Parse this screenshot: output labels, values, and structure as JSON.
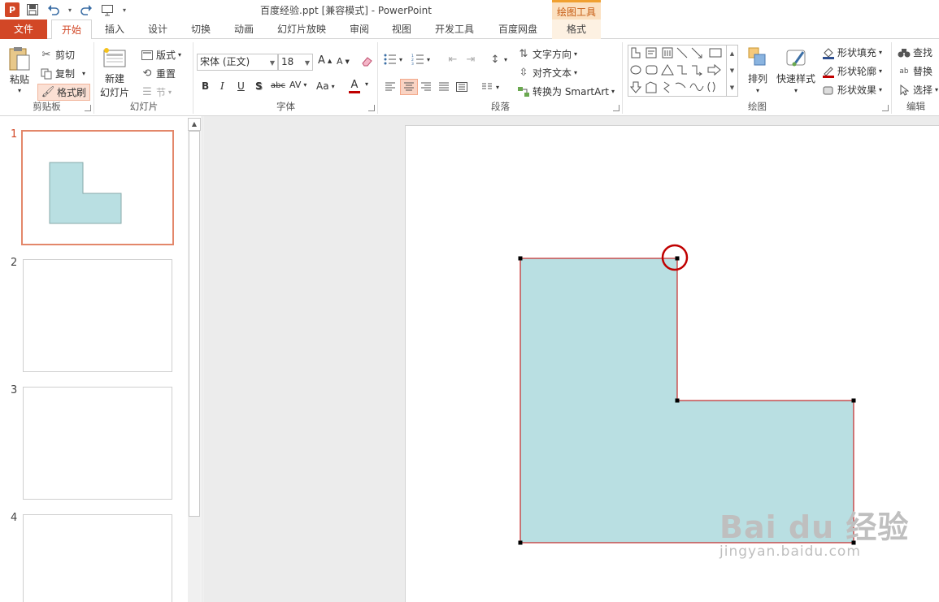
{
  "window": {
    "title": "百度经验.ppt [兼容模式] - PowerPoint",
    "contextual_group": "绘图工具"
  },
  "tabs": [
    "文件",
    "开始",
    "插入",
    "设计",
    "切换",
    "动画",
    "幻灯片放映",
    "审阅",
    "视图",
    "开发工具",
    "百度网盘",
    "格式"
  ],
  "active_tab": "开始",
  "ribbon": {
    "clipboard": {
      "label": "剪贴板",
      "paste": "粘贴",
      "cut": "剪切",
      "copy": "复制",
      "format_painter": "格式刷"
    },
    "slides": {
      "label": "幻灯片",
      "new_slide_line1": "新建",
      "new_slide_line2": "幻灯片",
      "layout": "版式",
      "reset": "重置",
      "section": "节"
    },
    "font": {
      "label": "字体",
      "font_name": "宋体 (正文)",
      "font_size": "18",
      "bold": "B",
      "italic": "I",
      "underline": "U",
      "shadow": "S",
      "strike": "abc",
      "spacing": "AV",
      "case": "Aa",
      "color": "A",
      "grow": "A",
      "shrink": "A"
    },
    "paragraph": {
      "label": "段落",
      "text_direction": "文字方向",
      "align_text": "对齐文本",
      "smartart": "转换为 SmartArt"
    },
    "drawing": {
      "label": "绘图",
      "arrange": "排列",
      "quick_styles": "快速样式",
      "shape_fill": "形状填充",
      "shape_outline": "形状轮廓",
      "shape_effects": "形状效果"
    },
    "editing": {
      "label": "编辑",
      "find": "查找",
      "replace": "替换",
      "select": "选择"
    }
  },
  "slides_panel": {
    "numbers": [
      "1",
      "2",
      "3",
      "4"
    ],
    "selected": 1
  },
  "slide_shape": {
    "fill": "#b9dfe2",
    "outline": "#c00000",
    "highlight_circle": "#c00000"
  },
  "watermark": {
    "brand": "Bai du 经验",
    "url": "jingyan.baidu.com"
  }
}
